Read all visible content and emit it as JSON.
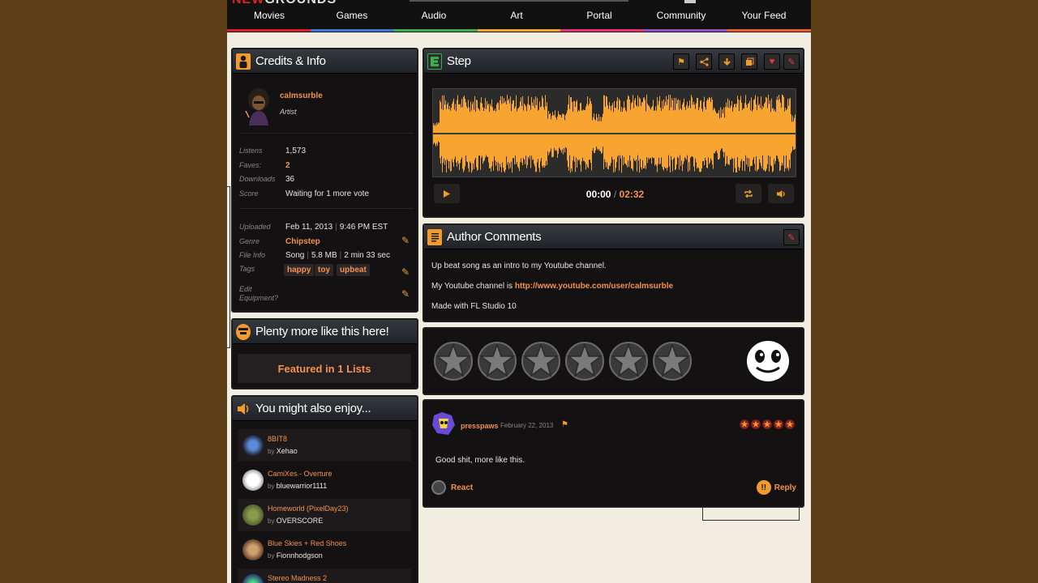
{
  "site": {
    "logo": "NEWGROUNDS",
    "nav": [
      "Movies",
      "Games",
      "Audio",
      "Art",
      "Portal",
      "Community",
      "Your Feed"
    ],
    "nav_colors": [
      "#d92027",
      "#3a7bd5",
      "#38b14a",
      "#f5a623",
      "#e6337a",
      "#8a56c6",
      "#f15a24"
    ]
  },
  "credits": {
    "title": "Credits & Info",
    "artist": {
      "name": "calmsurble",
      "role": "Artist"
    },
    "stats": {
      "listens_label": "Listens",
      "listens": "1,573",
      "faves_label": "Faves:",
      "faves": "2",
      "downloads_label": "Downloads",
      "downloads": "36",
      "score_label": "Score",
      "score": "Waiting for 1 more vote"
    },
    "details": {
      "uploaded_label": "Uploaded",
      "uploaded_date": "Feb 11, 2013",
      "uploaded_time": "9:46 PM EST",
      "genre_label": "Genre",
      "genre": "Chipstep",
      "fileinfo_label": "File Info",
      "file_type": "Song",
      "file_size": "5.8 MB",
      "file_length": "2 min 33 sec",
      "tags_label": "Tags",
      "tags": [
        "happy",
        "toy",
        "upbeat"
      ],
      "equipment_label": "Edit Equipment?"
    }
  },
  "plenty": {
    "title": "Plenty more like this here!",
    "featured": "Featured in 1 Lists"
  },
  "enjoy": {
    "title": "You might also enjoy...",
    "by": "by",
    "items": [
      {
        "title": "8BIT8",
        "author": "Xehao",
        "color": "#3a5a8a"
      },
      {
        "title": "CamiXes - Overture",
        "author": "bluewarrior1111",
        "color": "#e8e8e8"
      },
      {
        "title": "Homeworld (PixelDay23)",
        "author": "OVERSCORE",
        "color": "#6a7a3a"
      },
      {
        "title": "Blue Skies + Red Shoes",
        "author": "Fionnhodgson",
        "color": "#b08050"
      },
      {
        "title": "Stereo Madness 2",
        "author": "",
        "color": "#2a6a4a"
      }
    ]
  },
  "player": {
    "title": "Step",
    "time_current": "00:00",
    "time_sep": "/",
    "time_total": "02:32",
    "toolbar_icons": [
      "flag-icon",
      "share-icon",
      "download-icon",
      "playlist-icon",
      "heart-icon",
      "edit-icon"
    ]
  },
  "author_comments": {
    "title": "Author Comments",
    "line1": "Up beat song as an intro to my Youtube channel.",
    "line2_prefix": "My Youtube channel is",
    "line2_link": "http://www.youtube.com/user/calmsurble",
    "line3": "Made with FL Studio 10"
  },
  "rating": {
    "stars_total": 6
  },
  "review": {
    "user": "presspaws",
    "date": "February 22, 2013",
    "stars": 5,
    "text": "Good shit, more like this.",
    "react": "React",
    "reply": "Reply"
  },
  "colors": {
    "accent": "#f2924f",
    "waveform": "#f7a530",
    "panel": "#141112"
  }
}
